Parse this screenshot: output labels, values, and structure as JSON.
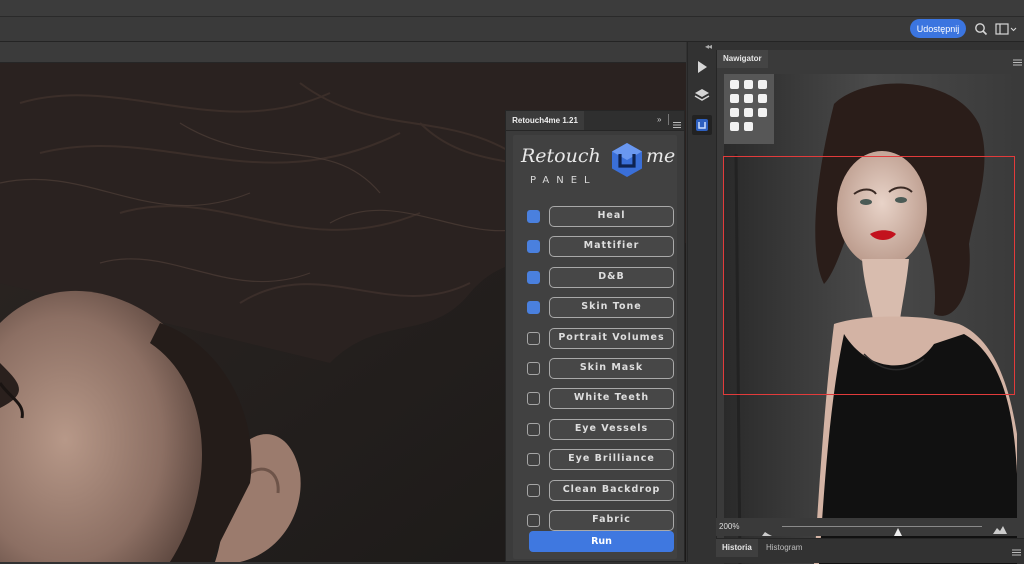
{
  "topbar": {
    "share_label": "Udostępnij"
  },
  "retouch_panel": {
    "tab_title": "Retouch4me 1.21",
    "logo_word_left": "Retouch",
    "logo_word_right": "me",
    "logo_subtitle": "PANEL",
    "filters": [
      {
        "label": "Heal",
        "checked": true
      },
      {
        "label": "Mattifier",
        "checked": true
      },
      {
        "label": "D&B",
        "checked": true
      },
      {
        "label": "Skin Tone",
        "checked": true
      },
      {
        "label": "Portrait Volumes",
        "checked": false
      },
      {
        "label": "Skin Mask",
        "checked": false
      },
      {
        "label": "White Teeth",
        "checked": false
      },
      {
        "label": "Eye Vessels",
        "checked": false
      },
      {
        "label": "Eye Brilliance",
        "checked": false
      },
      {
        "label": "Clean Backdrop",
        "checked": false
      },
      {
        "label": "Fabric",
        "checked": false
      }
    ],
    "run_label": "Run",
    "accent_color": "#3f78e0"
  },
  "navigator": {
    "tab_label": "Nawigator",
    "zoom": "200%"
  },
  "bottom_tabs": {
    "history": "Historia",
    "histogram": "Histogram"
  },
  "icons": [
    "search-icon",
    "workspace-icon",
    "play-icon",
    "layers-icon",
    "plugin-icon",
    "panel-menu-icon",
    "collapse-icon"
  ]
}
